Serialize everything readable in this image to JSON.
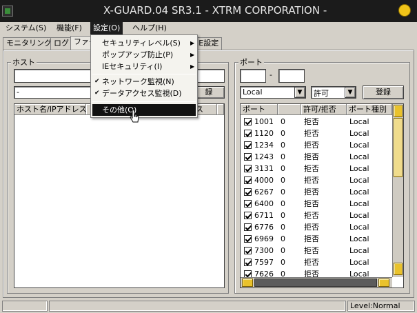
{
  "window": {
    "title": "X-GUARD.04 SR3.1 - XTRM CORPORATION -"
  },
  "colors": {
    "titlebar": "#1b1b1b",
    "menu_highlight": "#121212",
    "scroll_thumb": "#e9c22c"
  },
  "menu": [
    "システム(S)",
    "機能(F)",
    "設定(O)",
    "ヘルプ(H)"
  ],
  "tabs": [
    "モニタリング",
    "ログ",
    "ファイ",
    "IE設定"
  ],
  "settings_menu": {
    "items": [
      {
        "label": "セキュリティレベル(S)",
        "submenu": true,
        "checked": false
      },
      {
        "label": "ポップアップ防止(P)",
        "submenu": true,
        "checked": false
      },
      {
        "label": "IEセキュリティ(I)",
        "submenu": true,
        "checked": false
      },
      {
        "label": "ネットワーク監視(N)",
        "submenu": false,
        "checked": true
      },
      {
        "label": "データアクセス監視(D)",
        "submenu": false,
        "checked": true
      },
      {
        "label": "その他(O)",
        "submenu": false,
        "checked": false
      }
    ]
  },
  "host_panel": {
    "label": "ホスト",
    "input1_value": "",
    "input2_value": "-",
    "register_label_partial": "録",
    "columns": [
      "ホスト名/IPアドレス",
      "",
      "ス"
    ]
  },
  "port_panel": {
    "label": "ポート",
    "port_from": "",
    "dash": "-",
    "port_to": "",
    "type_select": "Local",
    "permit_select": "許可",
    "register_label": "登録",
    "columns": [
      "ポート",
      "",
      "許可/拒否",
      "ポート種別"
    ],
    "rows": [
      {
        "port": "1001",
        "col2": "0",
        "status": "拒否",
        "type": "Local"
      },
      {
        "port": "1120",
        "col2": "0",
        "status": "拒否",
        "type": "Local"
      },
      {
        "port": "1234",
        "col2": "0",
        "status": "拒否",
        "type": "Local"
      },
      {
        "port": "1243",
        "col2": "0",
        "status": "拒否",
        "type": "Local"
      },
      {
        "port": "3131",
        "col2": "0",
        "status": "拒否",
        "type": "Local"
      },
      {
        "port": "4000",
        "col2": "0",
        "status": "拒否",
        "type": "Local"
      },
      {
        "port": "6267",
        "col2": "0",
        "status": "拒否",
        "type": "Local"
      },
      {
        "port": "6400",
        "col2": "0",
        "status": "拒否",
        "type": "Local"
      },
      {
        "port": "6711",
        "col2": "0",
        "status": "拒否",
        "type": "Local"
      },
      {
        "port": "6776",
        "col2": "0",
        "status": "拒否",
        "type": "Local"
      },
      {
        "port": "6969",
        "col2": "0",
        "status": "拒否",
        "type": "Local"
      },
      {
        "port": "7300",
        "col2": "0",
        "status": "拒否",
        "type": "Local"
      },
      {
        "port": "7597",
        "col2": "0",
        "status": "拒否",
        "type": "Local"
      },
      {
        "port": "7626",
        "col2": "0",
        "status": "拒否",
        "type": "Local"
      }
    ]
  },
  "status_bar": {
    "level": "Level:Normal"
  }
}
